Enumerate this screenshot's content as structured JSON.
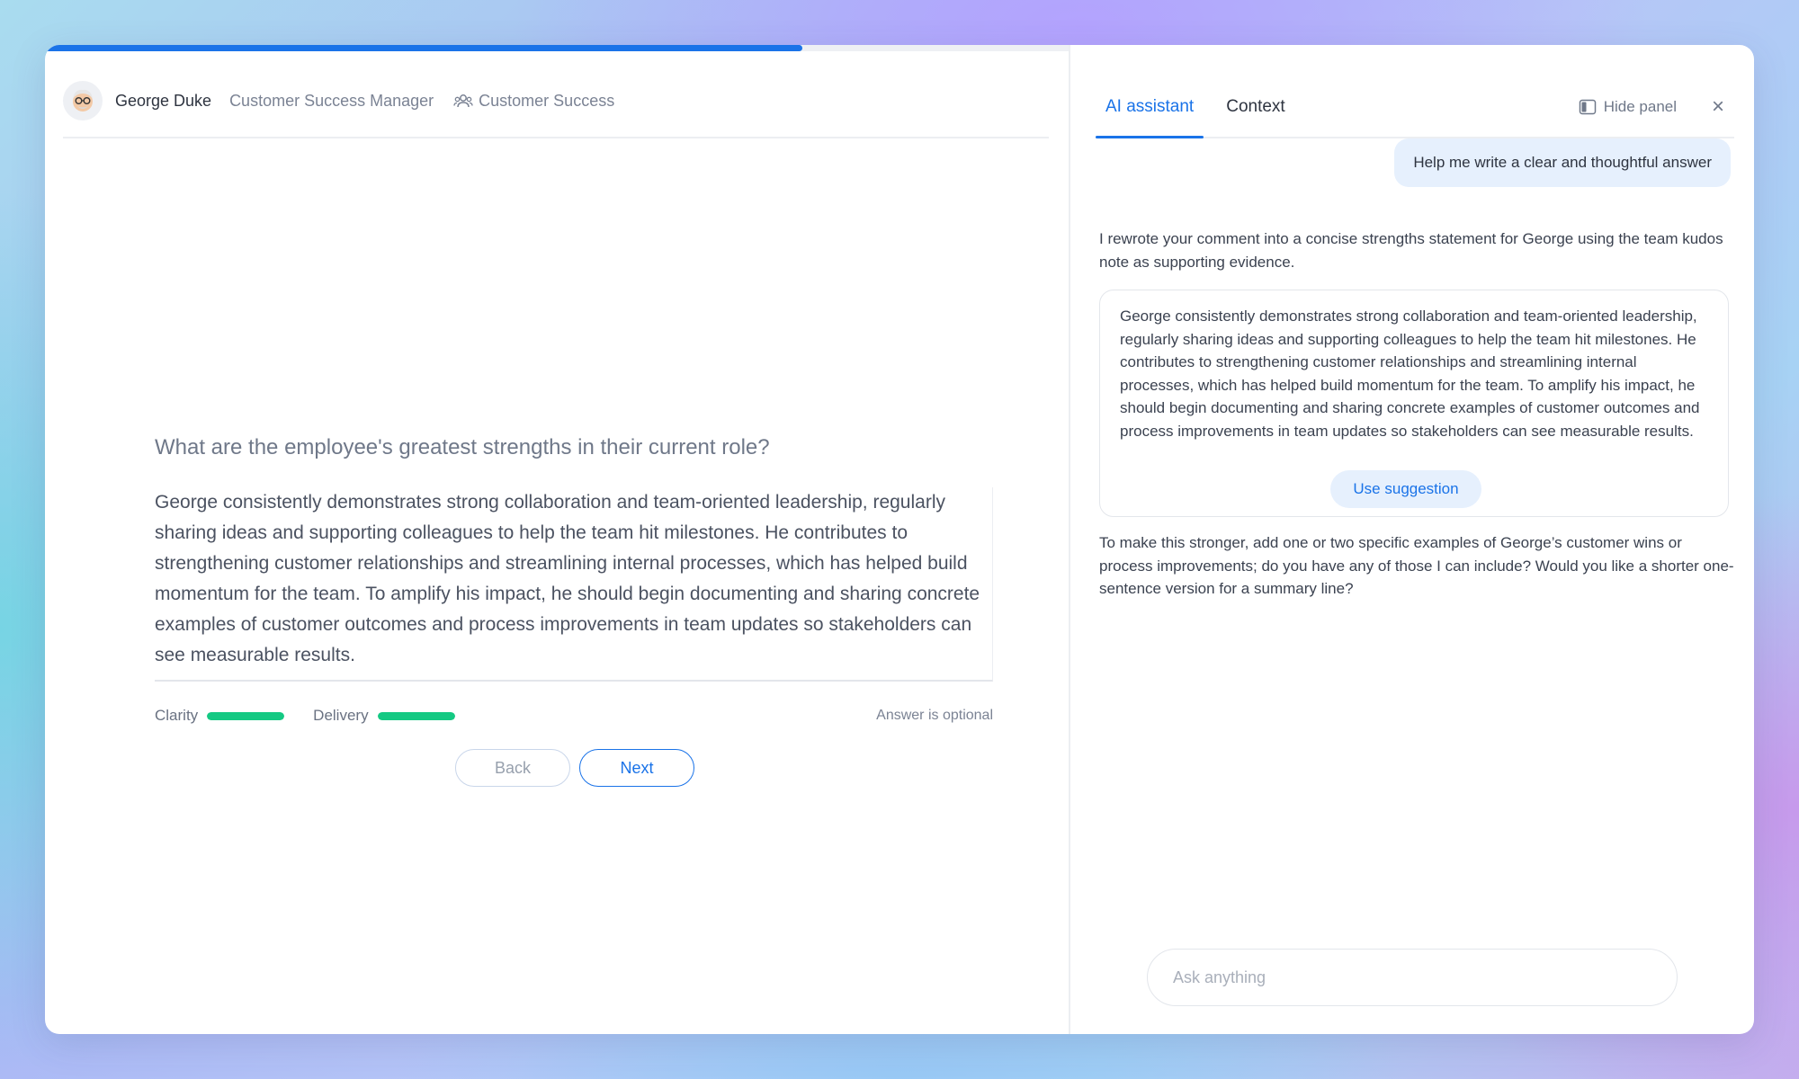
{
  "progress": {
    "fraction": 0.74
  },
  "header": {
    "name": "George Duke",
    "role": "Customer Success Manager",
    "team": "Customer Success"
  },
  "question": {
    "text": "What are the employee's greatest strengths in their current role?",
    "answer": "George consistently demonstrates strong collaboration and team-oriented leadership, regularly sharing ideas and supporting colleagues to help the team hit milestones. He contributes to strengthening customer relationships and streamlining internal processes, which has helped build momentum for the team. To amplify his impact, he should begin documenting and sharing concrete examples of customer outcomes and process improvements in team updates so stakeholders can see measurable results."
  },
  "meters": [
    {
      "label": "Clarity",
      "level": 1.0
    },
    {
      "label": "Delivery",
      "level": 1.0
    }
  ],
  "optional_note": "Answer is optional",
  "nav": {
    "back_label": "Back",
    "next_label": "Next"
  },
  "panel": {
    "tabs": [
      {
        "label": "AI assistant",
        "active": true
      },
      {
        "label": "Context",
        "active": false
      }
    ],
    "hide_label": "Hide panel",
    "user_message": "Help me write a clear and thoughtful answer",
    "ai_intro": "I rewrote your comment into a concise strengths statement for George using the team kudos note as supporting evidence.",
    "suggestion": "George consistently demonstrates strong collaboration and team-oriented leadership, regularly sharing ideas and supporting colleagues to help the team hit milestones. He contributes to strengthening customer relationships and streamlining internal processes, which has helped build momentum for the team. To amplify his impact, he should begin documenting and sharing concrete examples of customer outcomes and process improvements in team updates so stakeholders can see measurable results.",
    "use_label": "Use suggestion",
    "ai_followup": "To make this stronger, add one or two specific examples of George’s customer wins or process improvements; do you have any of those I can include? Would you like a shorter one-sentence version for a summary line?",
    "input_placeholder": "Ask anything"
  },
  "colors": {
    "accent": "#1a73e8",
    "meter": "#14c983"
  },
  "icons": {
    "team": "people-icon",
    "hide": "panel-toggle-icon",
    "close": "close-icon"
  }
}
